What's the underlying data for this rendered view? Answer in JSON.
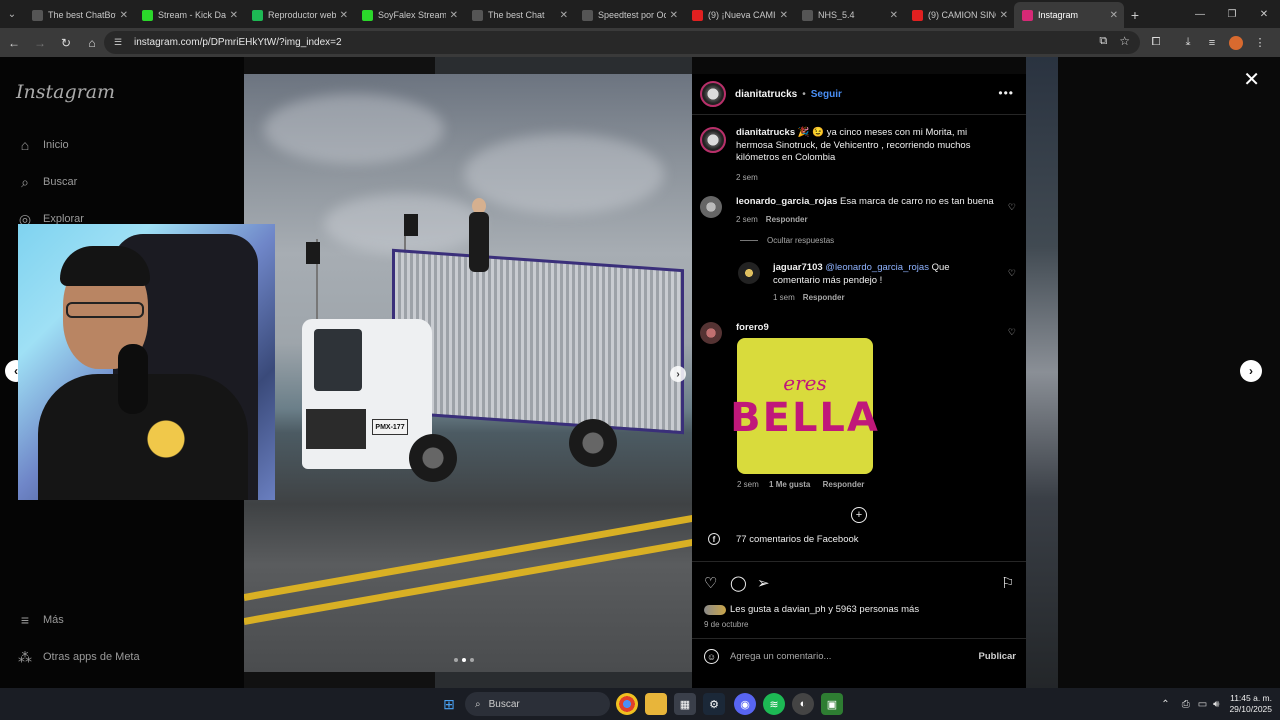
{
  "browser": {
    "tabs": [
      {
        "title": "The best ChatBot",
        "color": "#555555",
        "icon": "diamond-icon"
      },
      {
        "title": "Stream - Kick Dash",
        "color": "#2bd82b",
        "icon": "kick-icon"
      },
      {
        "title": "Reproductor web",
        "color": "#1db954",
        "icon": "spotify-icon"
      },
      {
        "title": "SoyFalex Stream",
        "color": "#2bd82b",
        "icon": "kick-icon"
      },
      {
        "title": "The best Chat",
        "color": "#555555",
        "icon": "diamond-icon"
      },
      {
        "title": "Speedtest por Ookla",
        "color": "#555555",
        "icon": "speedtest-icon"
      },
      {
        "title": "(9) ¡Nueva CAMIONETA",
        "color": "#e02020",
        "icon": "youtube-icon"
      },
      {
        "title": "NHS_5.4",
        "color": "#555555",
        "icon": "globe-icon"
      },
      {
        "title": "(9) CAMION SINOTRUK",
        "color": "#e02020",
        "icon": "youtube-icon"
      },
      {
        "title": "Instagram",
        "color": "#d62976",
        "icon": "instagram-icon"
      }
    ],
    "url": "instagram.com/p/DPmriEHkYtW/?img_index=2"
  },
  "sidebar": {
    "logo": "Instagram",
    "items": [
      {
        "label": "Inicio",
        "icon": "home-icon"
      },
      {
        "label": "Buscar",
        "icon": "search-icon"
      },
      {
        "label": "Explorar",
        "icon": "compass-icon"
      },
      {
        "label": "Más",
        "icon": "menu-icon"
      },
      {
        "label": "Otras apps de Meta",
        "icon": "meta-apps-icon"
      }
    ]
  },
  "photo": {
    "plate": "PMX-177",
    "carousel_dots": 3,
    "active_dot": 1
  },
  "post": {
    "author": "dianitatrucks",
    "separator": "•",
    "follow": "Seguir",
    "caption": "🎉 😉 ya cinco meses con mi Morita, mi hermosa Sinotruck, de Vehicentro , recorriendo muchos kilómetros en Colombia",
    "caption_time": "2 sem",
    "comments": [
      {
        "user": "leonardo_garcia_rojas",
        "text": "Esa marca de carro no es tan buena",
        "time": "2 sem",
        "reply": "Responder"
      },
      {
        "user": "jaguar7103",
        "mention": "@leonardo_garcia_rojas",
        "text": "Que comentario más pendejo !",
        "time": "1 sem",
        "reply": "Responder"
      },
      {
        "user": "forero9",
        "time": "2 sem",
        "likes": "1 Me gusta",
        "reply": "Responder"
      }
    ],
    "hide_replies": "Ocultar respuestas",
    "sticker": {
      "line1": "eres",
      "line2": "BELLA"
    },
    "facebook_comments": "77 comentarios de Facebook",
    "likes_text": "Les gusta a davian_ph y 5963 personas más",
    "date": "9 de octubre",
    "comment_placeholder": "Agrega un comentario...",
    "publish": "Publicar"
  },
  "taskbar": {
    "search": "Buscar",
    "time": "11:45 a. m.",
    "date": "29/10/2025"
  }
}
